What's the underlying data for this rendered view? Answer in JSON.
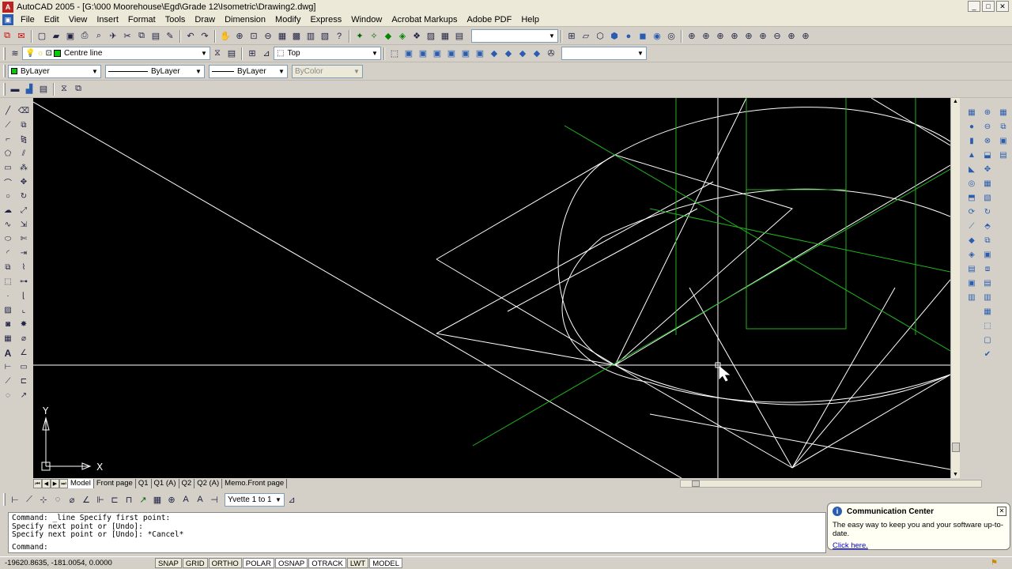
{
  "window": {
    "title": "AutoCAD 2005 - [G:\\000 Moorehouse\\Egd\\Grade 12\\Isometric\\Drawing2.dwg]",
    "app_icon": "A"
  },
  "menu": [
    "File",
    "Edit",
    "View",
    "Insert",
    "Format",
    "Tools",
    "Draw",
    "Dimension",
    "Modify",
    "Express",
    "Window",
    "Acrobat Markups",
    "Adobe PDF",
    "Help"
  ],
  "layers": {
    "current_layer": "Centre line"
  },
  "views": {
    "current_view": "Top"
  },
  "properties": {
    "color": "ByLayer",
    "linetype": "ByLayer",
    "lineweight": "ByLayer",
    "plotstyle": "ByColor"
  },
  "dim_style": {
    "current": "Yvette 1 to 1"
  },
  "ucs": {
    "x_label": "X",
    "y_label": "Y"
  },
  "tabs": [
    "Model",
    "Front page",
    "Q1",
    "Q1 (A)",
    "Q2",
    "Q2 (A)",
    "Memo.Front page"
  ],
  "command_lines": [
    "Command: _line Specify first point:",
    "Specify next point or [Undo]:",
    "Specify next point or [Undo]: *Cancel*",
    "Command:"
  ],
  "status": {
    "coordinates": "-19620.8635, -181.0054, 0.0000",
    "buttons": [
      {
        "label": "SNAP",
        "on": false
      },
      {
        "label": "GRID",
        "on": false
      },
      {
        "label": "ORTHO",
        "on": false
      },
      {
        "label": "POLAR",
        "on": true
      },
      {
        "label": "OSNAP",
        "on": true
      },
      {
        "label": "OTRACK",
        "on": true
      },
      {
        "label": "LWT",
        "on": false
      },
      {
        "label": "MODEL",
        "on": true
      }
    ]
  },
  "communication_center": {
    "title": "Communication Center",
    "body": "The easy way to keep you and your software up-to-date.",
    "link": "Click here."
  },
  "colors": {
    "canvas": "#000000",
    "white_lines": "#ffffff",
    "green_lines": "#1fb51f"
  }
}
